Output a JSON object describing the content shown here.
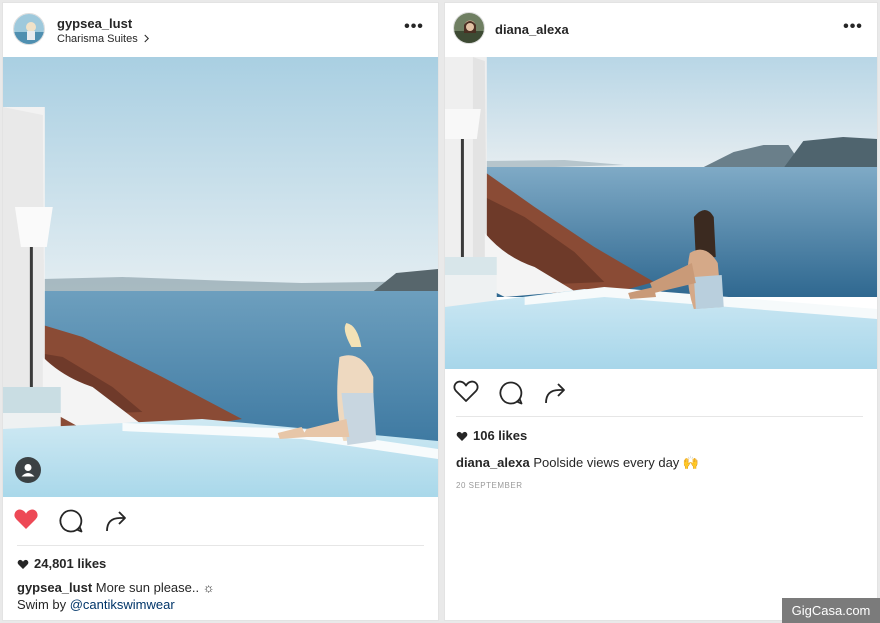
{
  "posts": [
    {
      "username": "gypsea_lust",
      "location": "Charisma Suites",
      "likes": "24,801 likes",
      "caption_user": "gypsea_lust",
      "caption_text": "More sun please.. ☼",
      "caption_line2": "Swim by ",
      "caption_link": "@cantikswimwear",
      "liked": true
    },
    {
      "username": "diana_alexa",
      "likes": "106 likes",
      "caption_user": "diana_alexa",
      "caption_text": "Poolside views every day 🙌",
      "date": "20 SEPTEMBER",
      "liked": false
    }
  ],
  "watermark": "GigCasa.com",
  "more_glyph": "•••",
  "colors": {
    "like_red": "#ed4956",
    "text": "#262626",
    "link": "#003569",
    "muted": "#9a9a9a"
  },
  "icons": [
    "heart-icon",
    "comment-icon",
    "share-icon",
    "more-options-icon",
    "profile-tag-icon"
  ]
}
